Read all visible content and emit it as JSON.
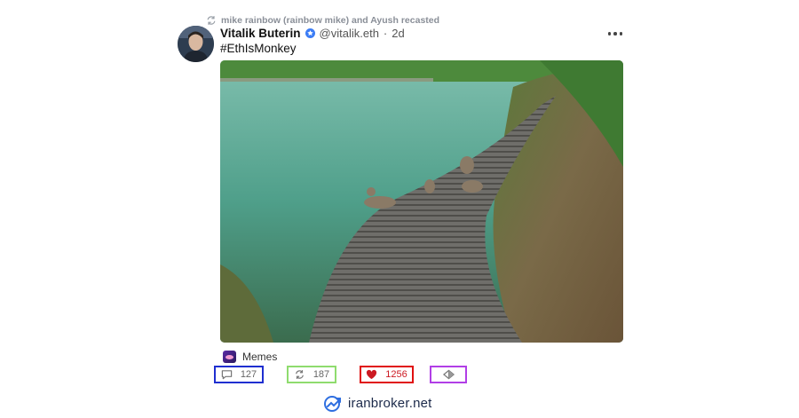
{
  "recast": {
    "text": "mike rainbow (rainbow mike) and Ayush recasted",
    "icon": "recast-icon"
  },
  "post": {
    "author_name": "Vitalik Buterin",
    "handle": "@vitalik.eth",
    "separator": "·",
    "time": "2d",
    "text": "#EthIsMonkey",
    "channel": "Memes"
  },
  "actions": {
    "replies": "127",
    "recasts": "187",
    "likes": "1256"
  },
  "footer": {
    "brand": "iranbroker.net"
  },
  "colors": {
    "reply_box": "#1f2fd0",
    "recast_box": "#8fdc6e",
    "like_box": "#e01010",
    "tip_box": "#b13ee6",
    "like_heart": "#cc1a22"
  }
}
